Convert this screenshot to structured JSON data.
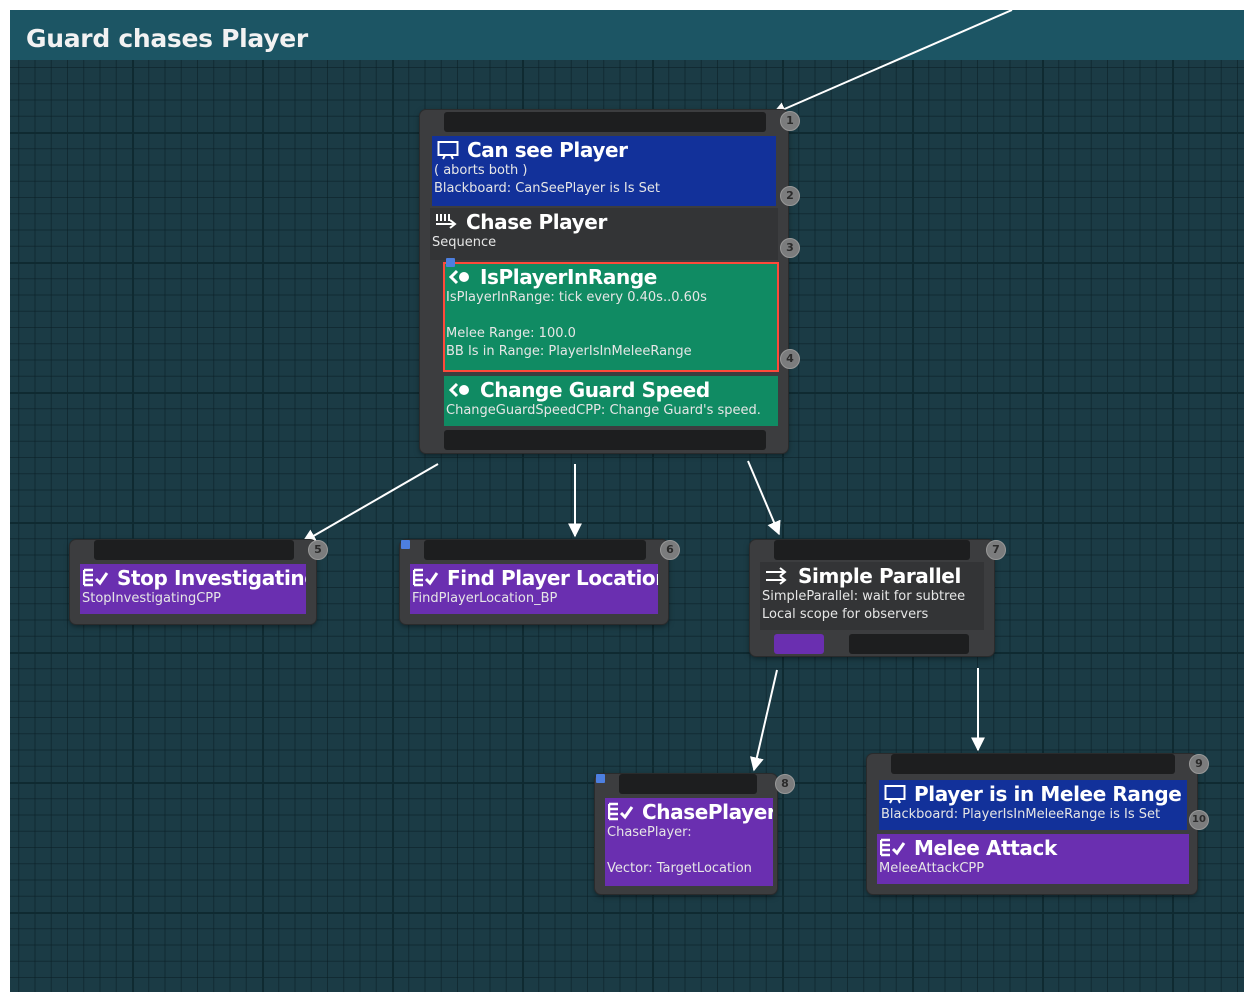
{
  "graph": {
    "title": "Guard chases Player"
  },
  "nodes": {
    "root": {
      "badges": [
        "1",
        "2",
        "3",
        "4"
      ],
      "decorator_can_see": {
        "title": "Can see Player",
        "line1": "( aborts both )",
        "line2": "Blackboard: CanSeePlayer is Is Set",
        "icon": "tv-icon"
      },
      "composite": {
        "title": "Chase Player",
        "line1": "Sequence",
        "icon": "sequence-icon"
      },
      "service_in_range": {
        "title": "IsPlayerInRange",
        "line1": "IsPlayerInRange: tick every 0.40s..0.60s",
        "line2": "Melee Range: 100.0",
        "line3": "BB Is in Range: PlayerIsInMeleeRange",
        "icon": "service-icon"
      },
      "service_speed": {
        "title": "Change Guard Speed",
        "line1": "ChangeGuardSpeedCPP: Change Guard's speed.",
        "icon": "service-icon"
      }
    },
    "stop_investigating": {
      "badge": "5",
      "title": "Stop Investigating",
      "line1": "StopInvestigatingCPP",
      "icon": "task-icon"
    },
    "find_player": {
      "badge": "6",
      "title": "Find Player Location",
      "line1": "FindPlayerLocation_BP",
      "icon": "task-icon"
    },
    "simple_parallel": {
      "badge": "7",
      "title": "Simple Parallel",
      "line1": "SimpleParallel: wait for subtree",
      "line2": "Local scope for observers",
      "icon": "parallel-icon"
    },
    "chase_player": {
      "badge": "8",
      "title": "ChasePlayer",
      "line1": "ChasePlayer:",
      "line2": "Vector: TargetLocation",
      "icon": "task-icon"
    },
    "melee": {
      "badges": [
        "9",
        "10"
      ],
      "decorator": {
        "title": "Player is in Melee Range",
        "line1": "Blackboard: PlayerIsInMeleeRange is Is Set",
        "icon": "tv-icon"
      },
      "task": {
        "title": "Melee Attack",
        "line1": "MeleeAttackCPP",
        "icon": "task-icon"
      }
    }
  },
  "colors": {
    "decorator": "#12319a",
    "service": "#108b63",
    "task": "#6a2fb0",
    "composite": "#333436",
    "wire": "#ffffff",
    "selection": "#ff4a3a",
    "background": "#1b3b45",
    "titlebar": "#1c5564"
  }
}
